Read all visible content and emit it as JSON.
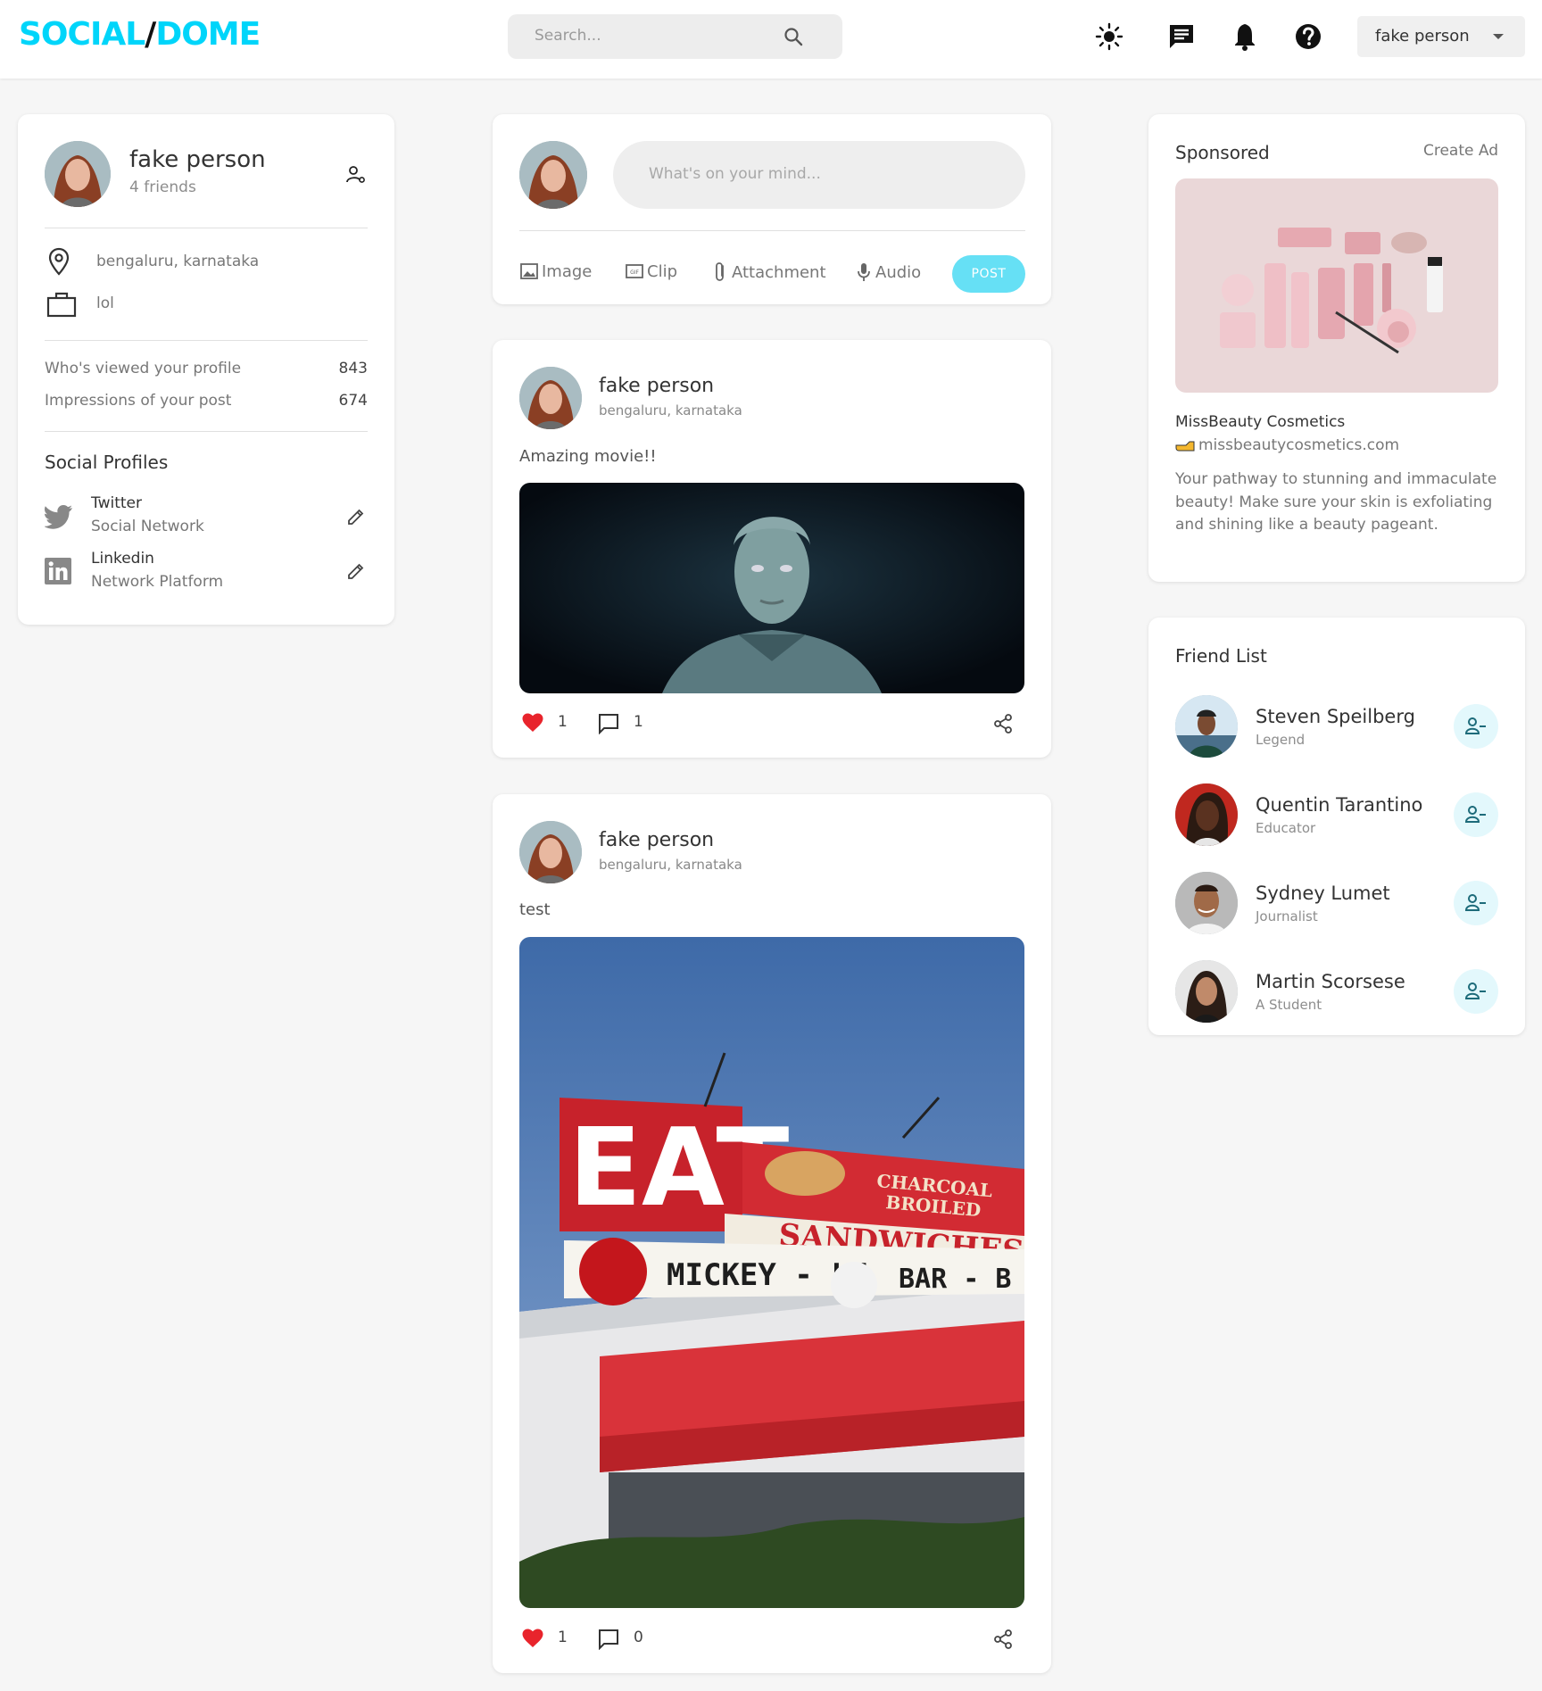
{
  "brand": {
    "part1": "SOCIAL",
    "slash": "/",
    "part2": "DOME"
  },
  "search": {
    "placeholder": "Search..."
  },
  "nav": {
    "icons": [
      "light-mode-icon",
      "message-icon",
      "notification-icon",
      "help-icon"
    ],
    "user_select_value": "fake person"
  },
  "colors": {
    "accent": "#00d5fa",
    "post_button": "#66e0f5",
    "like": "#e8242c"
  },
  "profile": {
    "name": "fake person",
    "friends": "4 friends",
    "location": "bengaluru, karnataka",
    "occupation": "lol",
    "stats": [
      {
        "label": "Who's viewed your profile",
        "value": "843"
      },
      {
        "label": "Impressions of your post",
        "value": "674"
      }
    ],
    "social_title": "Social Profiles",
    "socials": [
      {
        "name": "Twitter",
        "type": "Social Network"
      },
      {
        "name": "Linkedin",
        "type": "Network Platform"
      }
    ]
  },
  "composer": {
    "placeholder": "What's on your mind...",
    "actions": [
      "Image",
      "Clip",
      "Attachment",
      "Audio"
    ],
    "post_label": "POST"
  },
  "posts": [
    {
      "name": "fake person",
      "location": "bengaluru, karnataka",
      "text": "Amazing movie!!",
      "likes": "1",
      "comments": "1"
    },
    {
      "name": "fake person",
      "location": "bengaluru, karnataka",
      "text": "test",
      "likes": "1",
      "comments": "0",
      "image_text": {
        "eat": "EAT",
        "charcoal": "CHARCOAL",
        "broiled": "BROILED",
        "sandwiches": "SANDWICHES",
        "mickey": "MICKEY - LU",
        "bbq": "BAR - B - Q"
      }
    }
  ],
  "sponsored": {
    "title": "Sponsored",
    "create": "Create Ad",
    "brand": "MissBeauty Cosmetics",
    "url": "missbeautycosmetics.com",
    "description": "Your pathway to stunning and immaculate beauty! Make sure your skin is exfoliating and shining like a beauty pageant."
  },
  "friends": {
    "title": "Friend List",
    "items": [
      {
        "name": "Steven Speilberg",
        "role": "Legend"
      },
      {
        "name": "Quentin Tarantino",
        "role": "Educator"
      },
      {
        "name": "Sydney Lumet",
        "role": "Journalist"
      },
      {
        "name": "Martin Scorsese",
        "role": "A Student"
      }
    ]
  }
}
